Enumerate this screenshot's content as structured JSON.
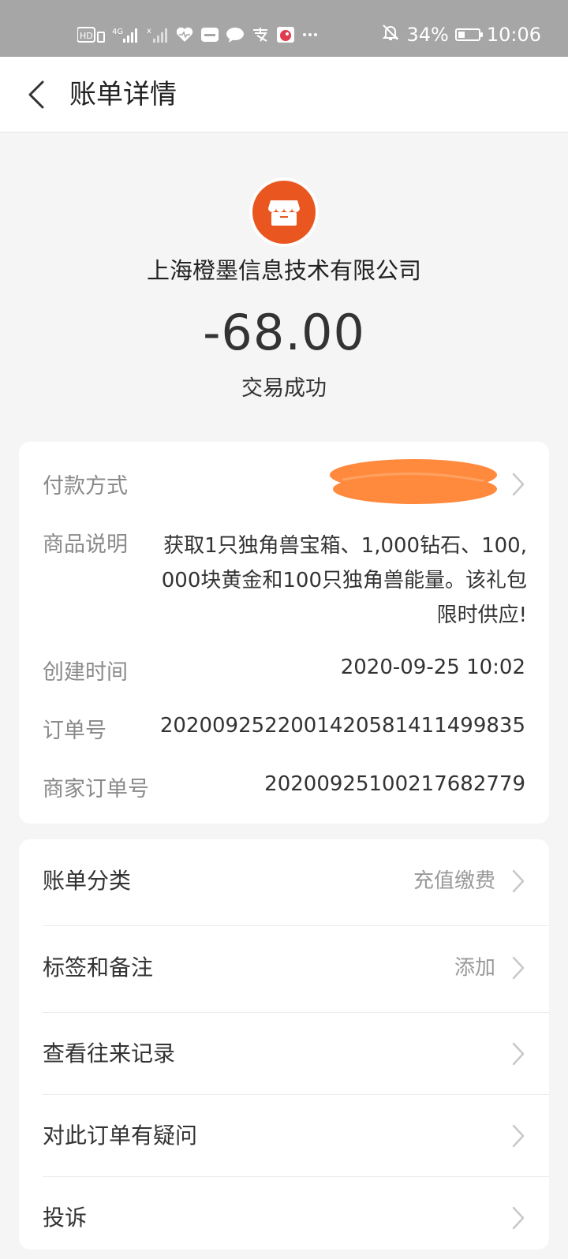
{
  "status_bar": {
    "battery_percent": "34%",
    "time": "10:06",
    "battery_level": 0.34
  },
  "header": {
    "title": "账单详情"
  },
  "merchant": {
    "name": "上海橙墨信息技术有限公司",
    "amount": "-68.00",
    "status": "交易成功",
    "logo_color": "#e9561f"
  },
  "details": {
    "payment_method_label": "付款方式",
    "product_label": "商品说明",
    "product_value": "获取1只独角兽宝箱、1,000钻石、100,000块黄金和100只独角兽能量。该礼包限时供应!",
    "created_label": "创建时间",
    "created_value": "2020-09-25 10:02",
    "order_no_label": "订单号",
    "order_no_value": "2020092522001420581411499835",
    "merchant_order_label": "商家订单号",
    "merchant_order_value": "20200925100217682779"
  },
  "actions": [
    {
      "label": "账单分类",
      "value": "充值缴费"
    },
    {
      "label": "标签和备注",
      "value": "添加"
    },
    {
      "label": "查看往来记录",
      "value": ""
    },
    {
      "label": "对此订单有疑问",
      "value": ""
    },
    {
      "label": "投诉",
      "value": ""
    }
  ],
  "colors": {
    "accent_orange": "#e9561f",
    "redaction_orange": "#ff8a3d",
    "label_gray": "#8a8a8a",
    "status_bar_gray": "#a6a6a6"
  }
}
